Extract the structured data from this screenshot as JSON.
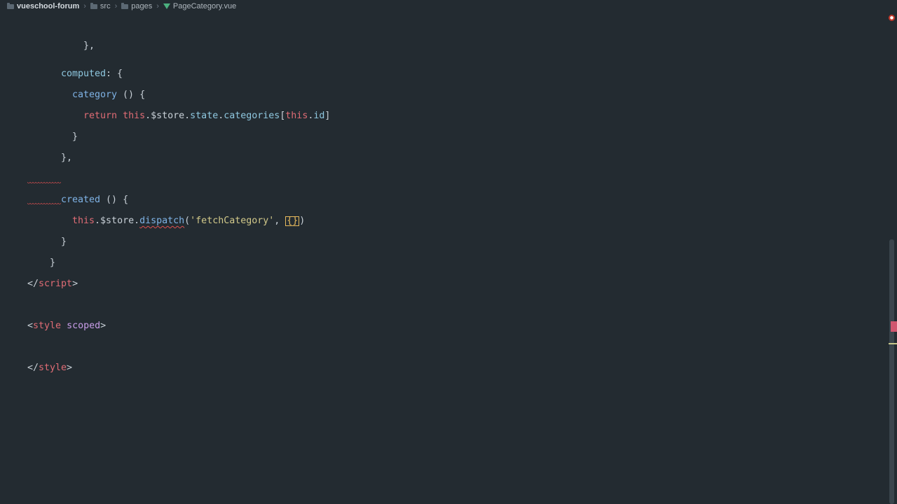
{
  "breadcrumb": [
    {
      "label": "vueschool-forum",
      "icon": "folder-icon"
    },
    {
      "label": "src",
      "icon": "folder-icon"
    },
    {
      "label": "pages",
      "icon": "folder-icon"
    },
    {
      "label": "PageCategory.vue",
      "icon": "vue-file-icon"
    }
  ],
  "breadcrumb_separator": "›",
  "code": {
    "l1": "},",
    "l2_key": "computed",
    "l2_rest": ": {",
    "l3_fn": "category",
    "l3_rest": " () {",
    "l4_return": "return",
    "l4_this1": "this",
    "l4_dot1": ".",
    "l4_store": "$store",
    "l4_dot2": ".",
    "l4_state": "state",
    "l4_dot3": ".",
    "l4_categories": "categories",
    "l4_open": "[",
    "l4_this2": "this",
    "l4_dot4": ".",
    "l4_id": "id",
    "l4_close": "]",
    "l5": "}",
    "l6": "},",
    "l7_fn": "created",
    "l7_rest": " () {",
    "l8_this": "this",
    "l8_dot1": ".",
    "l8_store": "$store",
    "l8_dot2": ".",
    "l8_dispatch": "dispatch",
    "l8_open": "(",
    "l8_str": "'fetchCategory'",
    "l8_comma": ", ",
    "l8_brace": "{}",
    "l8_close": ")",
    "l9": "}",
    "l10": "}",
    "l11_open": "</",
    "l11_tag": "script",
    "l11_close": ">",
    "l12_open": "<",
    "l12_tag": "style",
    "l12_attr": "scoped",
    "l12_close": ">",
    "l13_open": "</",
    "l13_tag": "style",
    "l13_close": ">"
  },
  "error_indicator": "●",
  "colors": {
    "background": "#232b31",
    "keyword": "#e06c75",
    "function": "#7fb3e6",
    "string": "#d2c98a",
    "cursor": "#e5b95c",
    "error": "#e05050"
  }
}
